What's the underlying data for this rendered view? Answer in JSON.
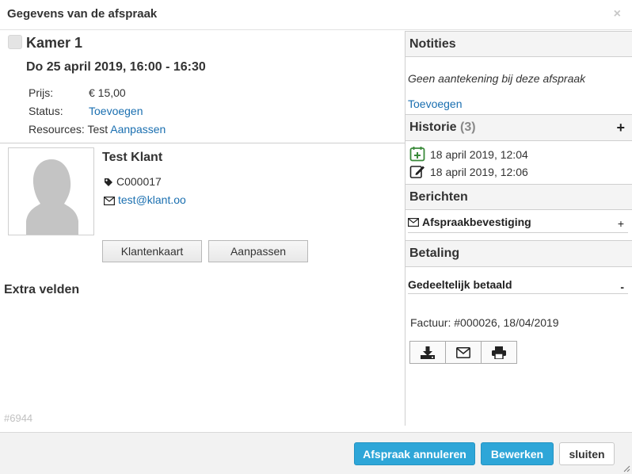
{
  "dialog": {
    "title": "Gegevens van de afspraak",
    "close_glyph": "×"
  },
  "appointment": {
    "room": "Kamer 1",
    "datetime": "Do 25 april 2019, 16:00 - 16:30",
    "price_label": "Prijs:",
    "price_value": "€ 15,00",
    "status_label": "Status:",
    "status_link": "Toevoegen",
    "resources_label": "Resources:",
    "resources_value": "Test",
    "resources_link": "Aanpassen",
    "id": "#6944"
  },
  "client": {
    "name": "Test Klant",
    "code": "C000017",
    "email": "test@klant.oo",
    "card_button": "Klantenkaart",
    "edit_button": "Aanpassen"
  },
  "extra_fields_heading": "Extra velden",
  "notes": {
    "heading": "Notities",
    "empty_text": "Geen aantekening bij deze afspraak",
    "add_link": "Toevoegen"
  },
  "history": {
    "heading": "Historie",
    "count": "(3)",
    "add_glyph": "+",
    "entries": [
      {
        "icon": "calendar-plus-icon",
        "text": "18 april 2019, 12:04"
      },
      {
        "icon": "edit-icon",
        "text": "18 april 2019, 12:06"
      }
    ]
  },
  "messages": {
    "heading": "Berichten",
    "item": "Afspraakbevestiging",
    "toggle": "+"
  },
  "payment": {
    "heading": "Betaling",
    "status": "Gedeeltelijk betaald",
    "toggle": "-",
    "invoice": "Factuur: #000026, 18/04/2019",
    "actions": [
      "download-icon",
      "mail-icon",
      "print-icon"
    ]
  },
  "footer": {
    "cancel_button": "Afspraak annuleren",
    "edit_button": "Bewerken",
    "close_button": "sluiten"
  },
  "colors": {
    "link": "#1a6fb0",
    "primary": "#2ea6d8",
    "history_add": "#3a8a3a"
  }
}
